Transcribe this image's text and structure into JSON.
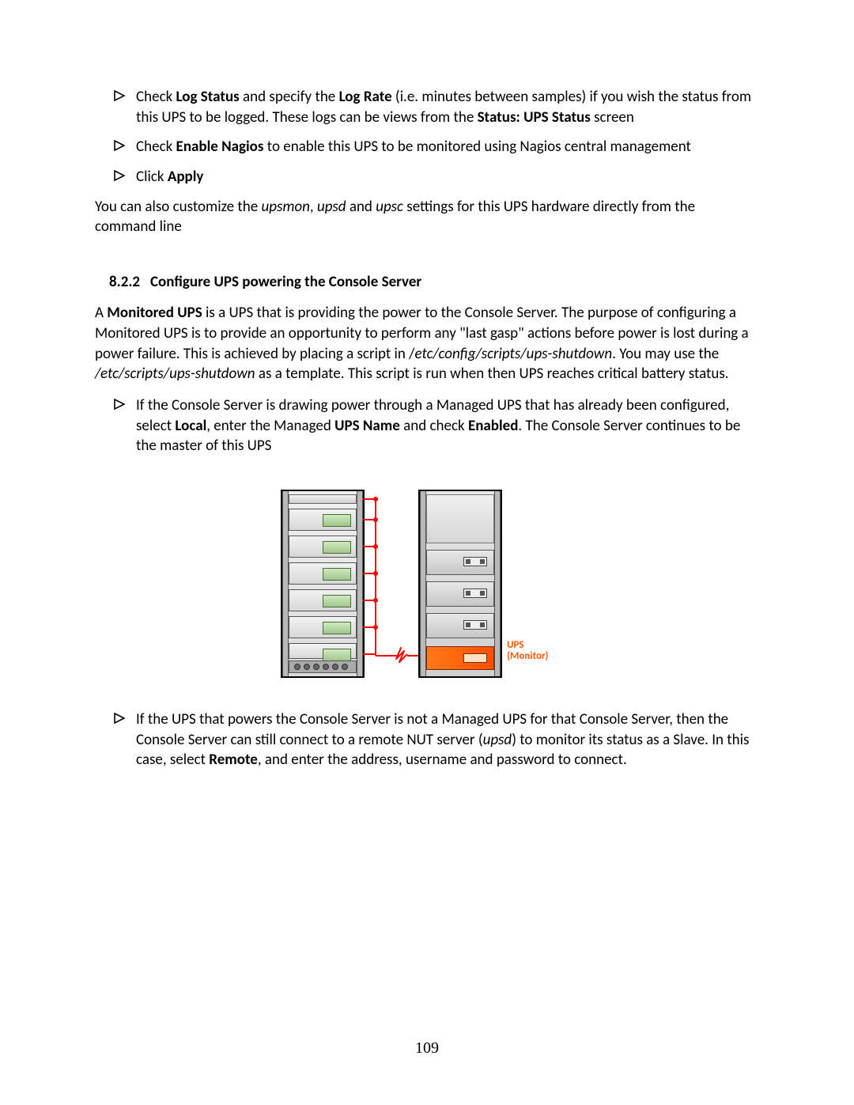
{
  "bullets_top": [
    {
      "pre": "Check ",
      "b1": "Log Status",
      "mid1": " and specify the ",
      "b2": "Log Rate",
      "mid2": " (i.e. minutes between samples) if you wish the status from this UPS to be logged. These logs can be views from the ",
      "b3": "Status: UPS Status",
      "post": " screen"
    },
    {
      "pre": "Check ",
      "b1": "Enable Nagios",
      "post": " to enable this UPS to be monitored using Nagios central management"
    },
    {
      "pre": "Click ",
      "b1": "Apply"
    }
  ],
  "para_after_bullets": {
    "t1": "You can also customize the ",
    "i1": "upsmon",
    "t2": ", ",
    "i2": "upsd",
    "t3": " and ",
    "i3": "upsc",
    "t4": " settings for this UPS hardware directly from the command line"
  },
  "section": {
    "num": "8.2.2",
    "title": "Configure UPS powering the Console Server"
  },
  "para_822": {
    "t1": "A ",
    "b1": "Monitored UPS",
    "t2": " is a UPS that is providing the power to the Console Server. The purpose of configuring a Monitored UPS is to provide an opportunity to perform any \"last gasp\" actions before power is lost during a power failure. This is achieved by placing a script in /",
    "i1": "etc/config/scripts/ups-shutdown",
    "t3": ". You may use the ",
    "i2": "/etc/scripts/ups-shutdown",
    "t4": " as a template. This script is run when then UPS reaches critical battery status."
  },
  "bullets_822": [
    {
      "t1": "If the Console Server is drawing power through a Managed UPS that has already been configured, select ",
      "b1": "Local",
      "t2": ", enter the Managed ",
      "b2": "UPS Name",
      "t3": " and check ",
      "b3": "Enabled",
      "t4": ". The Console Server continues to be the master of this UPS"
    },
    {
      "t1": "If the UPS that powers the Console Server is not a Managed UPS for that Console Server, then the Console Server can still connect to a remote NUT server (",
      "i1": "upsd",
      "t2": ") to monitor its status as a Slave. In this case, select ",
      "b1": "Remote",
      "t3": ", and enter the address, username and password to connect."
    }
  ],
  "figure": {
    "ups_label_line1": "UPS",
    "ups_label_line2": "(Monitor)"
  },
  "page_number": "109"
}
